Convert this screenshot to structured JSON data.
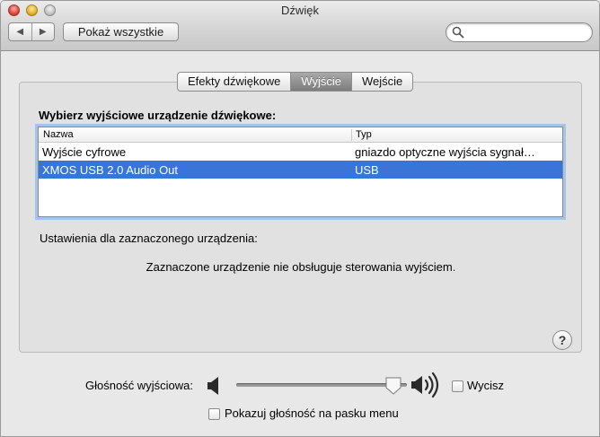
{
  "window": {
    "title": "Dźwięk"
  },
  "toolbar": {
    "back_icon": "◀",
    "forward_icon": "▶",
    "show_all_label": "Pokaż wszystkie",
    "search_placeholder": "",
    "search_value": ""
  },
  "tabs": [
    {
      "label": "Efekty dźwiękowe",
      "active": false
    },
    {
      "label": "Wyjście",
      "active": true
    },
    {
      "label": "Wejście",
      "active": false
    }
  ],
  "output": {
    "section_label": "Wybierz wyjściowe urządzenie dźwiękowe:",
    "columns": {
      "name": "Nazwa",
      "type": "Typ"
    },
    "devices": [
      {
        "name": "Wyjście cyfrowe",
        "type": "gniazdo optyczne wyjścia sygnał…",
        "selected": false
      },
      {
        "name": "XMOS USB 2.0 Audio Out",
        "type": "USB",
        "selected": true
      }
    ],
    "settings_label": "Ustawienia dla zaznaczonego urządzenia:",
    "message": "Zaznaczone urządzenie nie obsługuje sterowania wyjściem."
  },
  "help": {
    "label": "?"
  },
  "volume": {
    "label": "Głośność wyjściowa:",
    "level": 0.92,
    "mute_label": "Wycisz",
    "mute_checked": false,
    "show_in_menu_label": "Pokazuj głośność na pasku menu",
    "show_in_menu_checked": false
  },
  "colors": {
    "selection": "#3875d7",
    "focus_ring": "#a4c4ea"
  }
}
